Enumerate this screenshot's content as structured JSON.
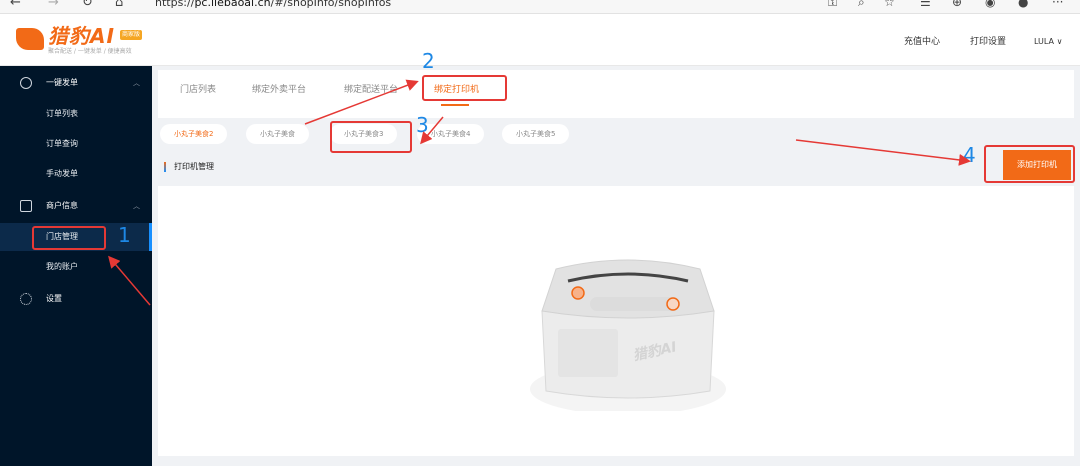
{
  "browser": {
    "nav": [
      "←",
      "→",
      "↻",
      "⌂"
    ],
    "url_scheme": "https://",
    "url_host": "pc.liebaoai.cn",
    "url_path": "/#/shopInfo/shopInfos",
    "right_icons": [
      "key-icon",
      "zoom-icon",
      "favorite-icon",
      "collections-icon",
      "extensions-icon",
      "profile-icon",
      "more-icon"
    ],
    "more": "···"
  },
  "header": {
    "logo_text": "猎豹AI",
    "logo_badge": "商家版",
    "logo_sub": "聚合配送 / 一键发单 / 便捷高效",
    "nav": [
      "充值中心",
      "打印设置"
    ],
    "user": "LULA ∨",
    "brand_color": "#f26a17"
  },
  "sidebar": {
    "groups": [
      {
        "label": "一键发单",
        "icon": "send-icon",
        "items": [
          "订单列表",
          "订单查询",
          "手动发单"
        ]
      },
      {
        "label": "商户信息",
        "icon": "store-icon",
        "items": [
          "门店管理",
          "我的账户"
        ]
      },
      {
        "label": "设置",
        "icon": "gear-icon",
        "items": []
      }
    ],
    "active_item": "门店管理"
  },
  "tabs": {
    "items": [
      "门店列表",
      "绑定外卖平台",
      "绑定配送平台",
      "绑定打印机"
    ],
    "active": "绑定打印机"
  },
  "shops": {
    "items": [
      "小丸子美食2",
      "小丸子美食",
      "小丸子美食3",
      "小丸子美食4",
      "小丸子美食5"
    ],
    "active": "小丸子美食2"
  },
  "section": {
    "title": "打印机管理",
    "add_button": "添加打印机"
  },
  "annotations": [
    "1",
    "2",
    "3",
    "4"
  ]
}
